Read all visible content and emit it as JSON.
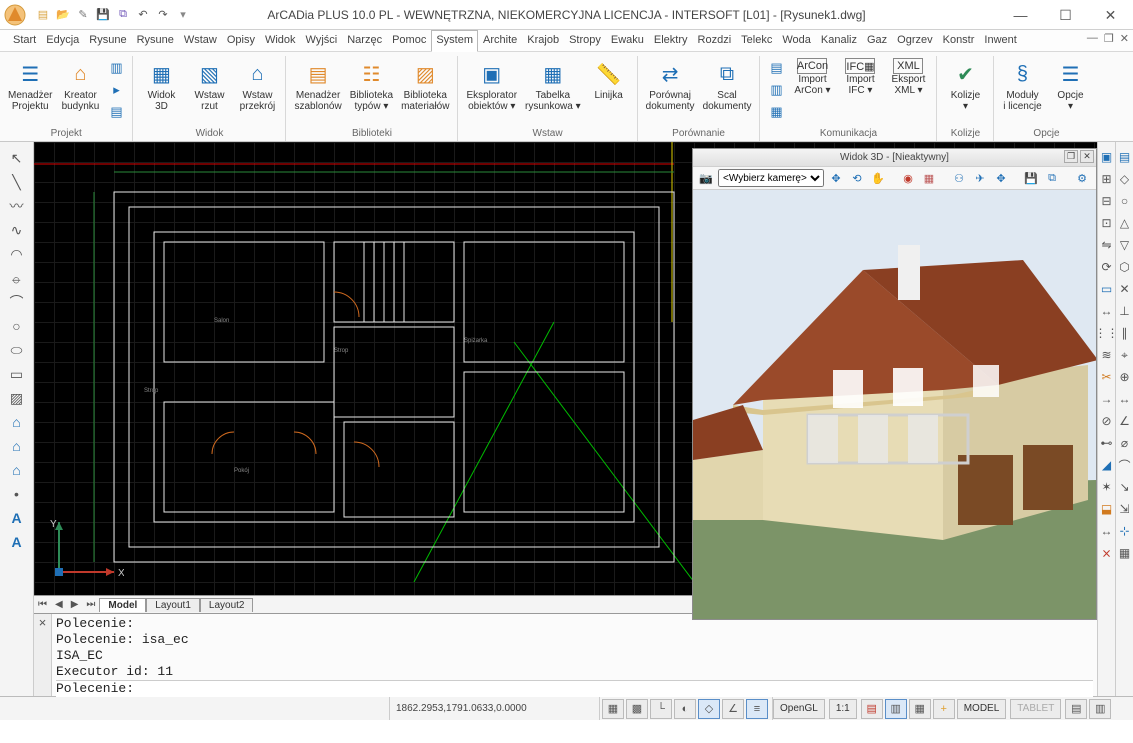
{
  "app": {
    "title": "ArCADia PLUS 10.0 PL - WEWNĘTRZNA, NIEKOMERCYJNA LICENCJA - INTERSOFT [L01] - [Rysunek1.dwg]"
  },
  "menu_tabs": [
    "Start",
    "Edycja",
    "Rysune",
    "Rysune",
    "Wstaw",
    "Opisy",
    "Widok",
    "Wyjści",
    "Narzęc",
    "Pomoc",
    "System",
    "Archite",
    "Krajob",
    "Stropy",
    "Ewaku",
    "Elektry",
    "Rozdzi",
    "Telekc",
    "Woda",
    "Kanaliz",
    "Gaz",
    "Ogrzev",
    "Konstr",
    "Inwent"
  ],
  "active_menu_tab": "System",
  "ribbon": {
    "projekt": {
      "label": "Projekt",
      "items": [
        {
          "label": "Menadżer\nProjektu"
        },
        {
          "label": "Kreator\nbudynku"
        }
      ]
    },
    "widok": {
      "label": "Widok",
      "items": [
        {
          "label": "Widok\n3D"
        },
        {
          "label": "Wstaw\nrzut"
        },
        {
          "label": "Wstaw\nprzekrój"
        }
      ]
    },
    "biblioteki": {
      "label": "Biblioteki",
      "items": [
        {
          "label": "Menadżer\nszablonów"
        },
        {
          "label": "Biblioteka\ntypów ▾"
        },
        {
          "label": "Biblioteka\nmateriałów"
        }
      ]
    },
    "wstaw": {
      "label": "Wstaw",
      "items": [
        {
          "label": "Eksplorator\nobiektów ▾"
        },
        {
          "label": "Tabelka\nrysunkowa ▾"
        },
        {
          "label": "Linijka"
        }
      ]
    },
    "porownanie": {
      "label": "Porównanie",
      "items": [
        {
          "label": "Porównaj\ndokumenty"
        },
        {
          "label": "Scal\ndokumenty"
        }
      ]
    },
    "komunikacja": {
      "label": "Komunikacja",
      "items": [
        {
          "label": "Import\nArCon ▾"
        },
        {
          "label": "Import\nIFC ▾"
        },
        {
          "label": "Eksport\nXML ▾"
        }
      ]
    },
    "kolizje": {
      "label": "Kolizje",
      "items": [
        {
          "label": "Kolizje\n▾"
        }
      ]
    },
    "opcje": {
      "label": "Opcje",
      "items": [
        {
          "label": "Moduły\ni licencje"
        },
        {
          "label": "Opcje\n▾"
        }
      ]
    }
  },
  "panel3d": {
    "title": "Widok 3D - [Nieaktywny]",
    "camera_placeholder": "<Wybierz kamerę>"
  },
  "sheet_tabs": [
    "Model",
    "Layout1",
    "Layout2"
  ],
  "active_sheet": "Model",
  "command_log": [
    "Polecenie:",
    "Polecenie: isa_ec",
    "ISA_EC",
    "Executor id: 11"
  ],
  "command_prompt": "Polecenie:",
  "status": {
    "coords": "1862.2953,1791.0633,0.0000",
    "renderer": "OpenGL",
    "zoom": "1:1",
    "model": "MODEL",
    "tablet": "TABLET"
  }
}
